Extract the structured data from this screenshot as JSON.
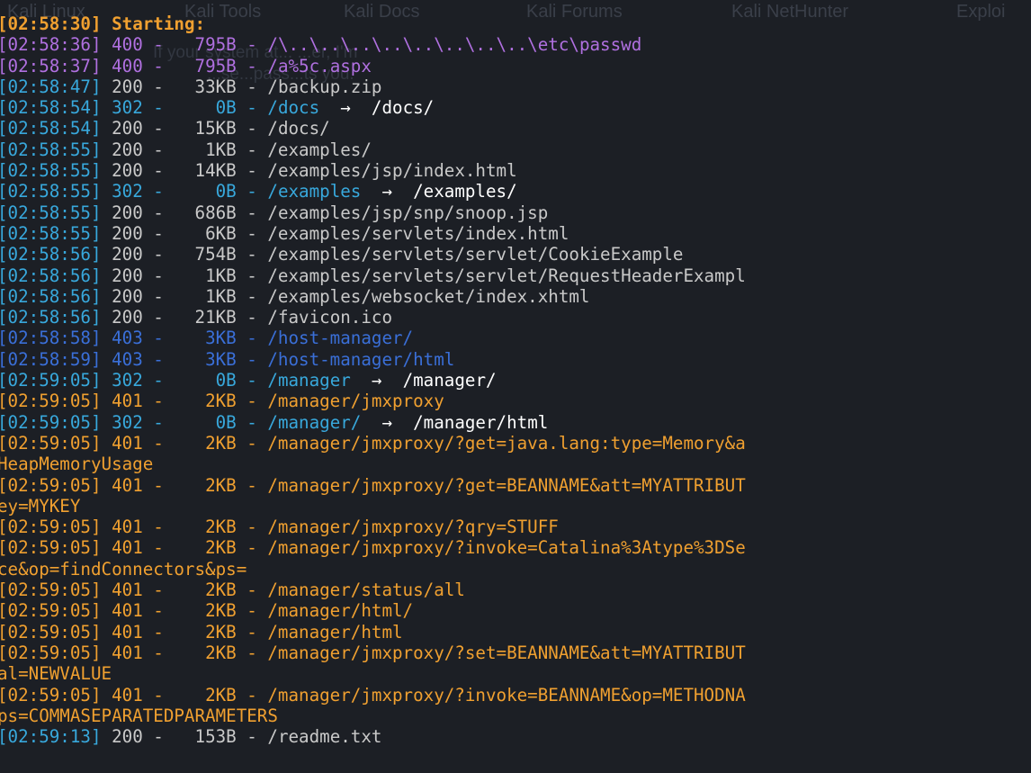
{
  "bookmarks": [
    "Kali Linux",
    "Kali Tools",
    "Kali Docs",
    "Kali Forums",
    "Kali NetHunter",
    "Exploi"
  ],
  "notice": [
    "If your system at...      ...er, I'm",
    "...se...pass...ts you."
  ],
  "starting": {
    "timestamp": "[02:58:30]",
    "label": "Starting:"
  },
  "entries": [
    {
      "ts": "[02:58:36]",
      "code": "400",
      "size": "795B",
      "path": "/\\..\\..\\..\\..\\..\\..\\..\\..\\etc\\passwd",
      "cls": "purple"
    },
    {
      "ts": "[02:58:37]",
      "code": "400",
      "size": "795B",
      "path": "/a%5c.aspx",
      "cls": "purple"
    },
    {
      "ts": "[02:58:47]",
      "code": "200",
      "size": "33KB",
      "path": "/backup.zip",
      "cls": "white"
    },
    {
      "ts": "[02:58:54]",
      "code": "302",
      "size": "0B",
      "path": "/docs",
      "redirect": "/docs/",
      "cls": "blue"
    },
    {
      "ts": "[02:58:54]",
      "code": "200",
      "size": "15KB",
      "path": "/docs/",
      "cls": "white"
    },
    {
      "ts": "[02:58:55]",
      "code": "200",
      "size": "1KB",
      "path": "/examples/",
      "cls": "white"
    },
    {
      "ts": "[02:58:55]",
      "code": "200",
      "size": "14KB",
      "path": "/examples/jsp/index.html",
      "cls": "white"
    },
    {
      "ts": "[02:58:55]",
      "code": "302",
      "size": "0B",
      "path": "/examples",
      "redirect": "/examples/",
      "cls": "blue"
    },
    {
      "ts": "[02:58:55]",
      "code": "200",
      "size": "686B",
      "path": "/examples/jsp/snp/snoop.jsp",
      "cls": "white"
    },
    {
      "ts": "[02:58:55]",
      "code": "200",
      "size": "6KB",
      "path": "/examples/servlets/index.html",
      "cls": "white"
    },
    {
      "ts": "[02:58:56]",
      "code": "200",
      "size": "754B",
      "path": "/examples/servlets/servlet/CookieExample",
      "cls": "white"
    },
    {
      "ts": "[02:58:56]",
      "code": "200",
      "size": "1KB",
      "path": "/examples/servlets/servlet/RequestHeaderExampl",
      "cls": "white"
    },
    {
      "ts": "[02:58:56]",
      "code": "200",
      "size": "1KB",
      "path": "/examples/websocket/index.xhtml",
      "cls": "white"
    },
    {
      "ts": "[02:58:56]",
      "code": "200",
      "size": "21KB",
      "path": "/favicon.ico",
      "cls": "white"
    },
    {
      "ts": "[02:58:58]",
      "code": "403",
      "size": "3KB",
      "path": "/host-manager/",
      "cls": "dblue"
    },
    {
      "ts": "[02:58:59]",
      "code": "403",
      "size": "3KB",
      "path": "/host-manager/html",
      "cls": "dblue"
    },
    {
      "ts": "[02:59:05]",
      "code": "302",
      "size": "0B",
      "path": "/manager",
      "redirect": "/manager/",
      "cls": "blue"
    },
    {
      "ts": "[02:59:05]",
      "code": "401",
      "size": "2KB",
      "path": "/manager/jmxproxy",
      "cls": "orange"
    },
    {
      "ts": "[02:59:05]",
      "code": "302",
      "size": "0B",
      "path": "/manager/",
      "redirect": "/manager/html",
      "cls": "blue"
    },
    {
      "ts": "[02:59:05]",
      "code": "401",
      "size": "2KB",
      "path": "/manager/jmxproxy/?get=java.lang:type=Memory&a",
      "cls": "orange"
    },
    {
      "wrap": "HeapMemoryUsage",
      "cls": "orange"
    },
    {
      "ts": "[02:59:05]",
      "code": "401",
      "size": "2KB",
      "path": "/manager/jmxproxy/?get=BEANNAME&att=MYATTRIBUT",
      "cls": "orange"
    },
    {
      "wrap": "ey=MYKEY",
      "cls": "orange"
    },
    {
      "ts": "[02:59:05]",
      "code": "401",
      "size": "2KB",
      "path": "/manager/jmxproxy/?qry=STUFF",
      "cls": "orange"
    },
    {
      "ts": "[02:59:05]",
      "code": "401",
      "size": "2KB",
      "path": "/manager/jmxproxy/?invoke=Catalina%3Atype%3DSe",
      "cls": "orange"
    },
    {
      "wrap": "ce&op=findConnectors&ps=",
      "cls": "orange"
    },
    {
      "ts": "[02:59:05]",
      "code": "401",
      "size": "2KB",
      "path": "/manager/status/all",
      "cls": "orange"
    },
    {
      "ts": "[02:59:05]",
      "code": "401",
      "size": "2KB",
      "path": "/manager/html/",
      "cls": "orange"
    },
    {
      "ts": "[02:59:05]",
      "code": "401",
      "size": "2KB",
      "path": "/manager/html",
      "cls": "orange"
    },
    {
      "ts": "[02:59:05]",
      "code": "401",
      "size": "2KB",
      "path": "/manager/jmxproxy/?set=BEANNAME&att=MYATTRIBUT",
      "cls": "orange"
    },
    {
      "wrap": "al=NEWVALUE",
      "cls": "orange"
    },
    {
      "ts": "[02:59:05]",
      "code": "401",
      "size": "2KB",
      "path": "/manager/jmxproxy/?invoke=BEANNAME&op=METHODNA",
      "cls": "orange"
    },
    {
      "wrap": "ps=COMMASEPARATEDPARAMETERS",
      "cls": "orange"
    },
    {
      "ts": "[02:59:13]",
      "code": "200",
      "size": "153B",
      "path": "/readme.txt",
      "cls": "white"
    }
  ],
  "colors": {
    "background": "#1c1f25",
    "timestamp": "#35a3d8",
    "ok": "#c9c9c9",
    "redirect": "#38a8dc",
    "forbidden": "#3a6fd8",
    "unauthorized": "#f0a030",
    "bad_request": "#b070e0"
  }
}
